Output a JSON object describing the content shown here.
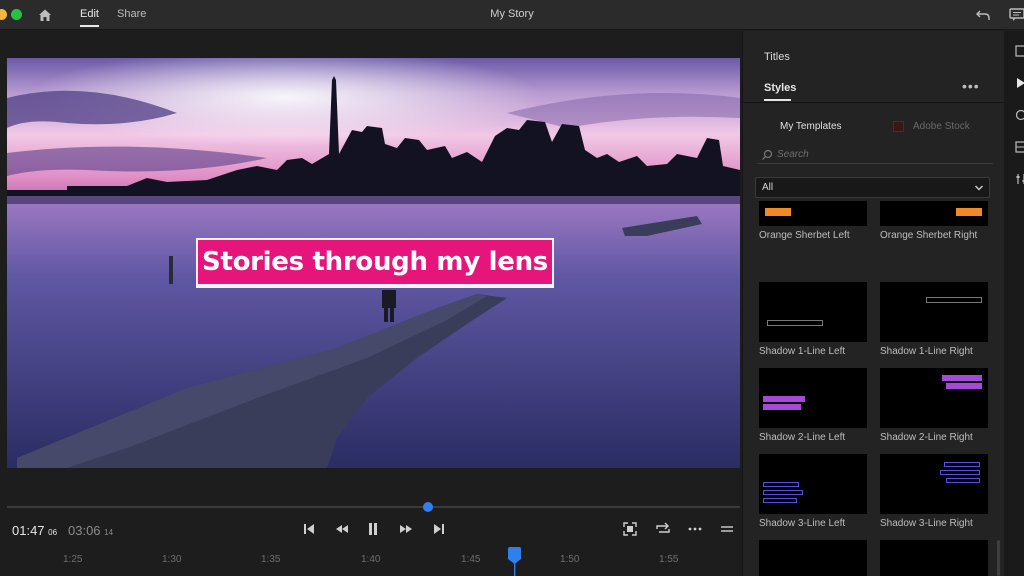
{
  "titlebar": {
    "tabs": [
      {
        "label": "Edit",
        "active": true
      },
      {
        "label": "Share",
        "active": false
      }
    ],
    "document_title": "My Story"
  },
  "monitor": {
    "title_text": "Stories through my lens",
    "title_bg_color": "#e6157b"
  },
  "playback": {
    "current_time": "01:47",
    "current_frames": "06",
    "total_time": "03:06",
    "total_frames": "14",
    "scrub_position": 0.57
  },
  "ruler": {
    "ticks": [
      "1:25",
      "1:30",
      "1:35",
      "1:40",
      "1:45",
      "1:50",
      "1:55"
    ]
  },
  "panel": {
    "heading": "Titles",
    "styles_tab": "Styles",
    "more_label": "•••",
    "source_tabs": [
      "My Templates",
      "Adobe Stock"
    ],
    "search_placeholder": "Search",
    "filter_value": "All",
    "templates": [
      {
        "name": "Orange Sherbet Left"
      },
      {
        "name": "Orange Sherbet Right"
      },
      {
        "name": "Shadow 1-Line Left"
      },
      {
        "name": "Shadow 1-Line Right"
      },
      {
        "name": "Shadow 2-Line Left"
      },
      {
        "name": "Shadow 2-Line Right"
      },
      {
        "name": "Shadow 3-Line Left"
      },
      {
        "name": "Shadow 3-Line Right"
      },
      {
        "name": ""
      },
      {
        "name": ""
      }
    ]
  },
  "colors": {
    "accent_blue": "#2f80ed",
    "orange_sherbet": "#f08a24",
    "purple_badge": "#a44ad6"
  }
}
